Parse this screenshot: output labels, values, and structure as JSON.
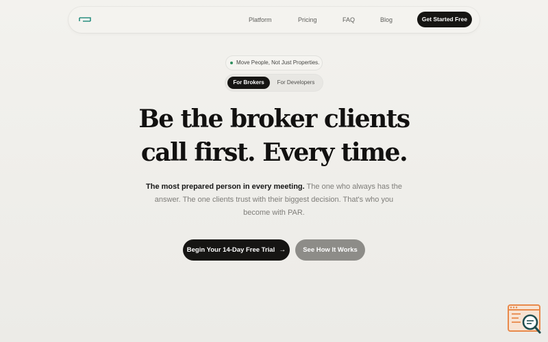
{
  "nav": {
    "logo": "logo-mark",
    "links": [
      "Platform",
      "Pricing",
      "FAQ",
      "Blog"
    ],
    "cta_label": "Get Started Free"
  },
  "hero": {
    "pill_text": "Move People, Not Just Properties.",
    "tabs": [
      "For Brokers",
      "For Developers"
    ],
    "active_tab": "For Brokers",
    "headline_line1": "Be the broker clients",
    "headline_line2": "call first. Every time.",
    "subtext_strong": "The most prepared person in every meeting.",
    "subtext_rest": " The one who always has the answer. The one clients trust with their biggest decision. That's who you become with PAR.",
    "primary_button": "Begin Your 14-Day Free Trial",
    "primary_button_icon": "arrow-right-icon",
    "secondary_button": "See How It Works"
  },
  "widget": {
    "icon": "search-chat-icon"
  },
  "colors": {
    "background": "#f0efeb",
    "dark": "#161513",
    "accent_green": "#2f8f5e",
    "secondary_button": "#8d8c88",
    "widget_orange": "#e8894a",
    "widget_teal": "#1f4d4f"
  }
}
